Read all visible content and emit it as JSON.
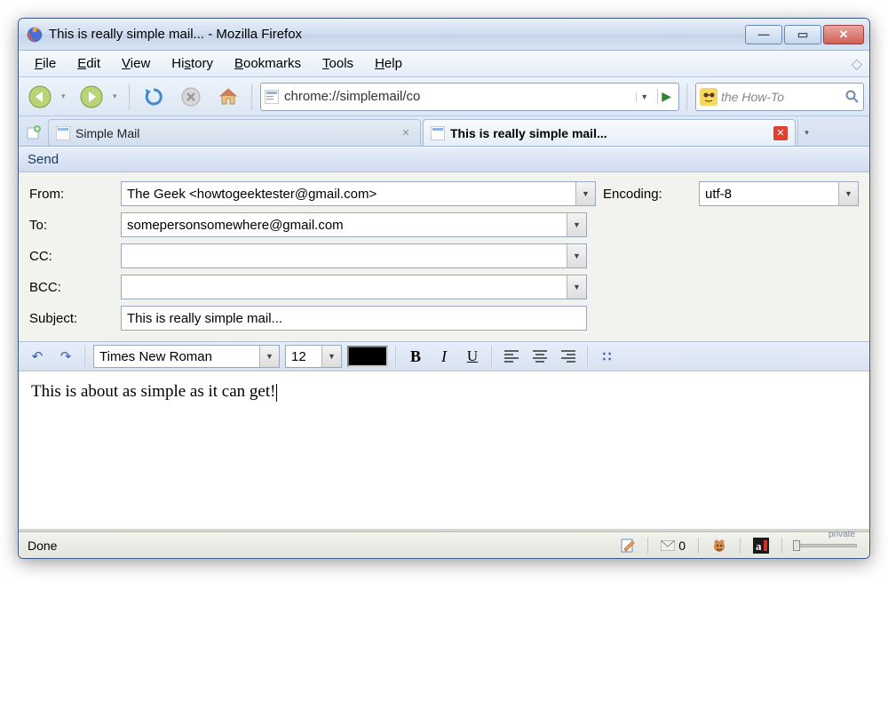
{
  "window": {
    "title": "This is really simple mail... - Mozilla Firefox"
  },
  "menu": {
    "file": "File",
    "edit": "Edit",
    "view": "View",
    "history": "History",
    "bookmarks": "Bookmarks",
    "tools": "Tools",
    "help": "Help"
  },
  "url": "chrome://simplemail/co",
  "search": {
    "placeholder": "the How-To"
  },
  "tabs": {
    "tab1_label": "Simple Mail",
    "tab2_label": "This is really simple mail..."
  },
  "compose": {
    "send_label": "Send",
    "from_label": "From:",
    "from_value": "The Geek <howtogeektester@gmail.com>",
    "encoding_label": "Encoding:",
    "encoding_value": "utf-8",
    "to_label": "To:",
    "to_value": "somepersonsomewhere@gmail.com",
    "cc_label": "CC:",
    "cc_value": "",
    "bcc_label": "BCC:",
    "bcc_value": "",
    "subject_label": "Subject:",
    "subject_value": "This is really simple mail..."
  },
  "editor": {
    "font": "Times New Roman",
    "size": "12",
    "body": "This is about as simple as it can get!"
  },
  "status": {
    "text": "Done",
    "mail_count": "0",
    "private_label": "private"
  }
}
